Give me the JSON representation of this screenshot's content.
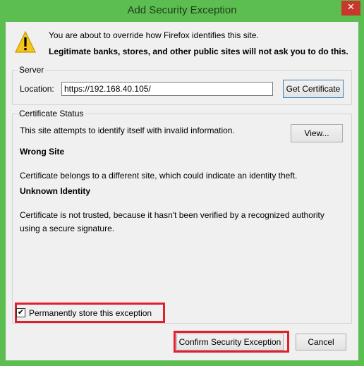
{
  "window": {
    "title": "Add Security Exception",
    "close_glyph": "✕"
  },
  "warning": {
    "icon": "warning-icon",
    "line1": "You are about to override how Firefox identifies this site.",
    "line2": "Legitimate banks, stores, and other public sites will not ask you to do this."
  },
  "server": {
    "group_label": "Server",
    "location_label": "Location:",
    "location_value": "https://192.168.40.105/",
    "get_certificate_label": "Get Certificate"
  },
  "certificate_status": {
    "group_label": "Certificate Status",
    "intro": "This site attempts to identify itself with invalid information.",
    "view_label": "View...",
    "wrong_site_heading": "Wrong Site",
    "wrong_site_text": "Certificate belongs to a different site, which could indicate an identity theft.",
    "unknown_identity_heading": "Unknown Identity",
    "unknown_identity_text_1": "Certificate is not trusted, because it hasn't been verified by a recognized authority",
    "unknown_identity_text_2": "using a secure signature."
  },
  "permanent": {
    "checked": true,
    "check_glyph": "✔",
    "label": "Permanently store this exception"
  },
  "buttons": {
    "confirm_label": "Confirm Security Exception",
    "cancel_label": "Cancel"
  },
  "colors": {
    "titlebar": "#5cbe50",
    "highlight": "#e0202a",
    "close": "#c7372c"
  }
}
